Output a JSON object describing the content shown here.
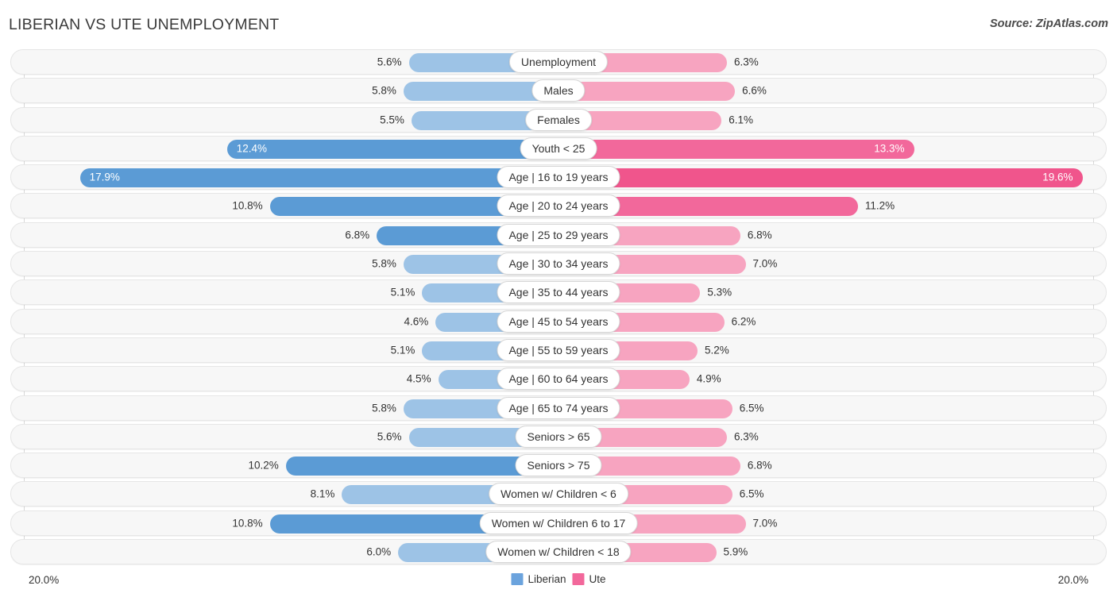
{
  "header": {
    "title": "LIBERIAN VS UTE UNEMPLOYMENT",
    "source": "Source: ZipAtlas.com"
  },
  "footer": {
    "axis_left": "20.0%",
    "axis_right": "20.0%",
    "legend": [
      {
        "label": "Liberian",
        "color": "#6ba3dd",
        "swatch": "blue"
      },
      {
        "label": "Ute",
        "color": "#f2689b",
        "swatch": "pink"
      }
    ]
  },
  "chart_data": {
    "type": "bar",
    "title": "LIBERIAN VS UTE UNEMPLOYMENT",
    "subtitle": "",
    "orientation": "horizontal-diverging",
    "xlabel": "",
    "ylabel": "",
    "xlim": [
      -20.0,
      20.0
    ],
    "axis_max": 20.0,
    "unit": "%",
    "grid": true,
    "legend_position": "bottom-center",
    "categories": [
      "Unemployment",
      "Males",
      "Females",
      "Youth < 25",
      "Age | 16 to 19 years",
      "Age | 20 to 24 years",
      "Age | 25 to 29 years",
      "Age | 30 to 34 years",
      "Age | 35 to 44 years",
      "Age | 45 to 54 years",
      "Age | 55 to 59 years",
      "Age | 60 to 64 years",
      "Age | 65 to 74 years",
      "Seniors > 65",
      "Seniors > 75",
      "Women w/ Children < 6",
      "Women w/ Children 6 to 17",
      "Women w/ Children < 18"
    ],
    "series": [
      {
        "name": "Liberian",
        "color": "#9dc3e6",
        "side": "left",
        "values": [
          5.6,
          5.8,
          5.5,
          12.4,
          17.9,
          10.8,
          6.8,
          5.8,
          5.1,
          4.6,
          5.1,
          4.5,
          5.8,
          5.6,
          10.2,
          8.1,
          10.8,
          6.0
        ]
      },
      {
        "name": "Ute",
        "color": "#f7a4c0",
        "side": "right",
        "values": [
          6.3,
          6.6,
          6.1,
          13.3,
          19.6,
          11.2,
          6.8,
          7.0,
          5.3,
          6.2,
          5.2,
          4.9,
          6.5,
          6.3,
          6.8,
          6.5,
          7.0,
          5.9
        ]
      }
    ]
  },
  "rows": [
    {
      "label": "Unemployment",
      "left": "5.6%",
      "right": "6.3%",
      "left_val": 5.6,
      "right_val": 6.3,
      "left_shade": "lite",
      "right_shade": "lite",
      "left_inside": false,
      "right_inside": false
    },
    {
      "label": "Males",
      "left": "5.8%",
      "right": "6.6%",
      "left_val": 5.8,
      "right_val": 6.6,
      "left_shade": "lite",
      "right_shade": "lite",
      "left_inside": false,
      "right_inside": false
    },
    {
      "label": "Females",
      "left": "5.5%",
      "right": "6.1%",
      "left_val": 5.5,
      "right_val": 6.1,
      "left_shade": "lite",
      "right_shade": "lite",
      "left_inside": false,
      "right_inside": false
    },
    {
      "label": "Youth < 25",
      "left": "12.4%",
      "right": "13.3%",
      "left_val": 12.4,
      "right_val": 13.3,
      "left_shade": "dark",
      "right_shade": "dark",
      "left_inside": true,
      "right_inside": true
    },
    {
      "label": "Age | 16 to 19 years",
      "left": "17.9%",
      "right": "19.6%",
      "left_val": 17.9,
      "right_val": 19.6,
      "left_shade": "max",
      "right_shade": "max",
      "left_inside": true,
      "right_inside": true
    },
    {
      "label": "Age | 20 to 24 years",
      "left": "10.8%",
      "right": "11.2%",
      "left_val": 10.8,
      "right_val": 11.2,
      "left_shade": "dark",
      "right_shade": "dark",
      "left_inside": false,
      "right_inside": false
    },
    {
      "label": "Age | 25 to 29 years",
      "left": "6.8%",
      "right": "6.8%",
      "left_val": 6.8,
      "right_val": 6.8,
      "left_shade": "dark",
      "right_shade": "lite",
      "left_inside": false,
      "right_inside": false
    },
    {
      "label": "Age | 30 to 34 years",
      "left": "5.8%",
      "right": "7.0%",
      "left_val": 5.8,
      "right_val": 7.0,
      "left_shade": "lite",
      "right_shade": "lite",
      "left_inside": false,
      "right_inside": false
    },
    {
      "label": "Age | 35 to 44 years",
      "left": "5.1%",
      "right": "5.3%",
      "left_val": 5.1,
      "right_val": 5.3,
      "left_shade": "lite",
      "right_shade": "lite",
      "left_inside": false,
      "right_inside": false
    },
    {
      "label": "Age | 45 to 54 years",
      "left": "4.6%",
      "right": "6.2%",
      "left_val": 4.6,
      "right_val": 6.2,
      "left_shade": "lite",
      "right_shade": "lite",
      "left_inside": false,
      "right_inside": false
    },
    {
      "label": "Age | 55 to 59 years",
      "left": "5.1%",
      "right": "5.2%",
      "left_val": 5.1,
      "right_val": 5.2,
      "left_shade": "lite",
      "right_shade": "lite",
      "left_inside": false,
      "right_inside": false
    },
    {
      "label": "Age | 60 to 64 years",
      "left": "4.5%",
      "right": "4.9%",
      "left_val": 4.5,
      "right_val": 4.9,
      "left_shade": "lite",
      "right_shade": "lite",
      "left_inside": false,
      "right_inside": false
    },
    {
      "label": "Age | 65 to 74 years",
      "left": "5.8%",
      "right": "6.5%",
      "left_val": 5.8,
      "right_val": 6.5,
      "left_shade": "lite",
      "right_shade": "lite",
      "left_inside": false,
      "right_inside": false
    },
    {
      "label": "Seniors > 65",
      "left": "5.6%",
      "right": "6.3%",
      "left_val": 5.6,
      "right_val": 6.3,
      "left_shade": "lite",
      "right_shade": "lite",
      "left_inside": false,
      "right_inside": false
    },
    {
      "label": "Seniors > 75",
      "left": "10.2%",
      "right": "6.8%",
      "left_val": 10.2,
      "right_val": 6.8,
      "left_shade": "dark",
      "right_shade": "lite",
      "left_inside": false,
      "right_inside": false
    },
    {
      "label": "Women w/ Children < 6",
      "left": "8.1%",
      "right": "6.5%",
      "left_val": 8.1,
      "right_val": 6.5,
      "left_shade": "lite",
      "right_shade": "lite",
      "left_inside": false,
      "right_inside": false
    },
    {
      "label": "Women w/ Children 6 to 17",
      "left": "10.8%",
      "right": "7.0%",
      "left_val": 10.8,
      "right_val": 7.0,
      "left_shade": "dark",
      "right_shade": "lite",
      "left_inside": false,
      "right_inside": false
    },
    {
      "label": "Women w/ Children < 18",
      "left": "6.0%",
      "right": "5.9%",
      "left_val": 6.0,
      "right_val": 5.9,
      "left_shade": "lite",
      "right_shade": "lite",
      "left_inside": false,
      "right_inside": false
    }
  ]
}
